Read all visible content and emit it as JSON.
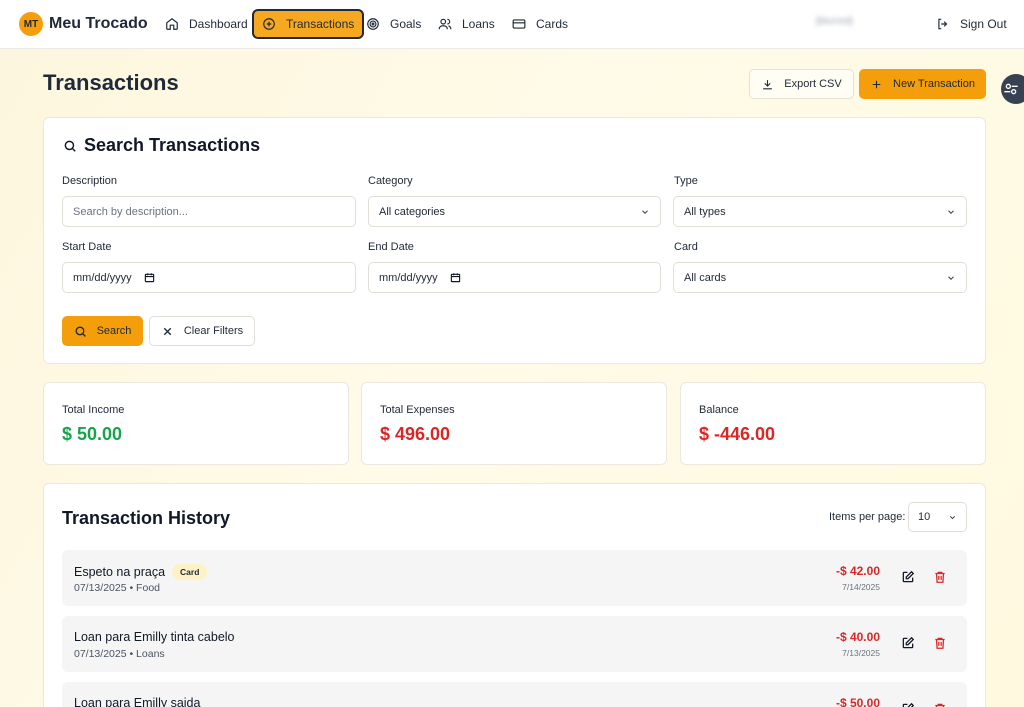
{
  "nav": {
    "brand_initials": "MT",
    "brand_name": "Meu Trocado",
    "items": [
      {
        "label": "Dashboard",
        "icon": "home-icon"
      },
      {
        "label": "Transactions",
        "icon": "plus-circle-icon",
        "active": true
      },
      {
        "label": "Goals",
        "icon": "target-icon"
      },
      {
        "label": "Loans",
        "icon": "users-icon"
      },
      {
        "label": "Cards",
        "icon": "credit-card-icon"
      }
    ],
    "user_email": "[blurred]",
    "sign_out_label": "Sign Out"
  },
  "header": {
    "title": "Transactions",
    "export_label": "Export CSV",
    "new_label": "New Transaction"
  },
  "search": {
    "title": "Search Transactions",
    "description_label": "Description",
    "description_placeholder": "Search by description...",
    "category_label": "Category",
    "category_value": "All categories",
    "type_label": "Type",
    "type_value": "All types",
    "start_date_label": "Start Date",
    "start_date_value": "mm/dd/yyyy",
    "end_date_label": "End Date",
    "end_date_value": "mm/dd/yyyy",
    "card_label": "Card",
    "card_value": "All cards",
    "search_button": "Search",
    "clear_button": "Clear Filters"
  },
  "summary": {
    "income_label": "Total Income",
    "income_value": "$ 50.00",
    "expenses_label": "Total Expenses",
    "expenses_value": "$ 496.00",
    "balance_label": "Balance",
    "balance_value": "$ -446.00",
    "colors": {
      "income": "#16a34a",
      "expense": "#dc2626",
      "accent": "#f59e0b"
    }
  },
  "history": {
    "title": "Transaction History",
    "items_per_page_label": "Items per page:",
    "items_per_page_value": "10",
    "rows": [
      {
        "name": "Espeto na praça",
        "badge": "Card",
        "meta": "07/13/2025 • Food",
        "amount": "-$ 42.00",
        "date": "7/14/2025"
      },
      {
        "name": "Loan para Emilly tinta cabelo",
        "badge": "",
        "meta": "07/13/2025 • Loans",
        "amount": "-$ 40.00",
        "date": "7/13/2025"
      },
      {
        "name": "Loan para Emilly saida",
        "badge": "",
        "meta": "",
        "amount": "-$ 50.00",
        "date": ""
      }
    ]
  }
}
